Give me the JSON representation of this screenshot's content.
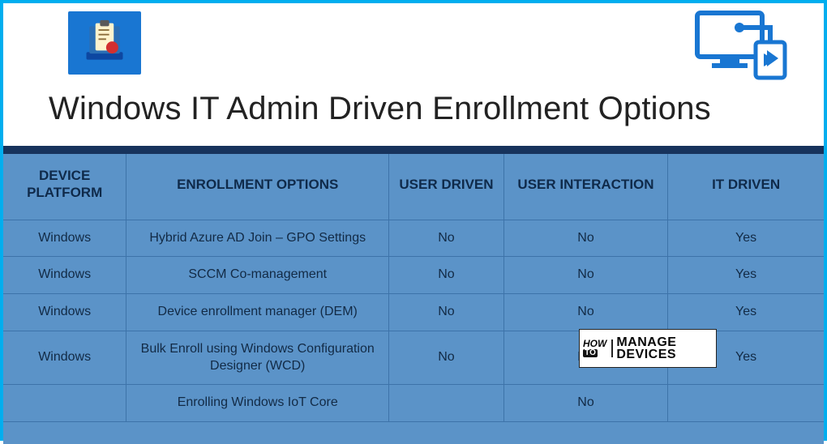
{
  "title": "Windows IT Admin Driven Enrollment Options",
  "table": {
    "headers": {
      "c1": "DEVICE PLATFORM",
      "c2": "ENROLLMENT OPTIONS",
      "c3": "USER DRIVEN",
      "c4": "USER INTERACTION",
      "c5": "IT DRIVEN"
    },
    "rows": [
      {
        "c1": "Windows",
        "c2": "Hybrid Azure AD Join – GPO Settings",
        "c3": "No",
        "c4": "No",
        "c5": "Yes"
      },
      {
        "c1": "Windows",
        "c2": "SCCM Co-management",
        "c3": "No",
        "c4": "No",
        "c5": "Yes"
      },
      {
        "c1": "Windows",
        "c2": "Device enrollment manager (DEM)",
        "c3": "No",
        "c4": "No",
        "c5": "Yes"
      },
      {
        "c1": "Windows",
        "c2": "Bulk Enroll using Windows Configuration Designer (WCD)",
        "c3": "No",
        "c4": "No",
        "c5": "Yes"
      },
      {
        "c1": "",
        "c2": "Enrolling Windows IoT Core",
        "c3": "",
        "c4": "No",
        "c5": ""
      }
    ]
  },
  "watermark": {
    "how": "HOW",
    "to": "TO",
    "line1": "MANAGE",
    "line2": "DEVICES"
  }
}
